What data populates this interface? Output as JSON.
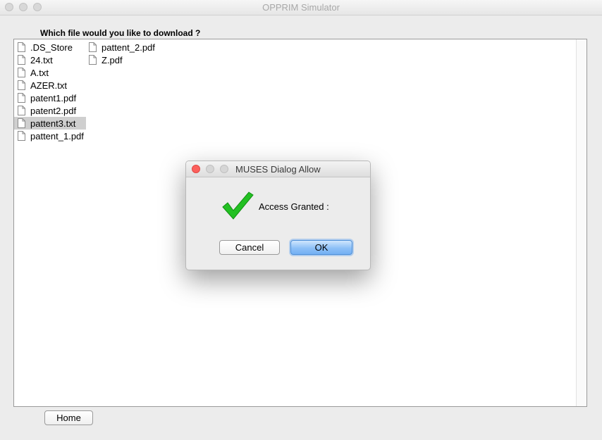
{
  "window": {
    "title": "OPPRIM Simulator"
  },
  "prompt": {
    "question": "Which file would you like to download ?"
  },
  "files": [
    {
      "name": ".DS_Store",
      "selected": false
    },
    {
      "name": "24.txt",
      "selected": false
    },
    {
      "name": "A.txt",
      "selected": false
    },
    {
      "name": "AZER.txt",
      "selected": false
    },
    {
      "name": "patent1.pdf",
      "selected": false
    },
    {
      "name": "patent2.pdf",
      "selected": false
    },
    {
      "name": "pattent3.txt",
      "selected": true
    },
    {
      "name": "pattent_1.pdf",
      "selected": false
    },
    {
      "name": "pattent_2.pdf",
      "selected": false
    },
    {
      "name": "Z.pdf",
      "selected": false
    }
  ],
  "buttons": {
    "home": "Home"
  },
  "dialog": {
    "title": "MUSES Dialog Allow",
    "message": "Access Granted :",
    "cancel_label": "Cancel",
    "ok_label": "OK",
    "icon": "checkmark-icon",
    "icon_color": "#22c022"
  },
  "colors": {
    "selection": "#cfcfcf",
    "close_button": "#fc605c",
    "ok_button": "#8dc0f7"
  }
}
